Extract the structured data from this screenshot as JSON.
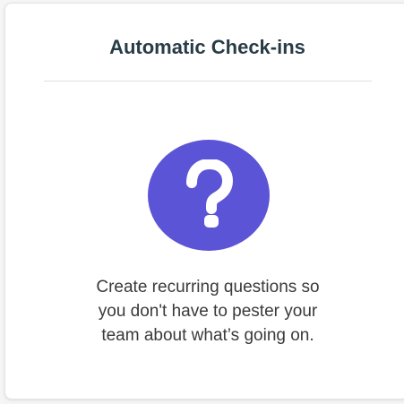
{
  "card": {
    "title": "Automatic Check-ins",
    "icon": "question-icon",
    "description_lines": [
      "Create recurring questions so",
      "you don't have to pester your",
      "team about what’s going on."
    ]
  },
  "colors": {
    "icon_circle": "#5b54d6",
    "title_text": "#283c46",
    "body_text": "#3a3a3a",
    "card_background": "#ffffff"
  }
}
